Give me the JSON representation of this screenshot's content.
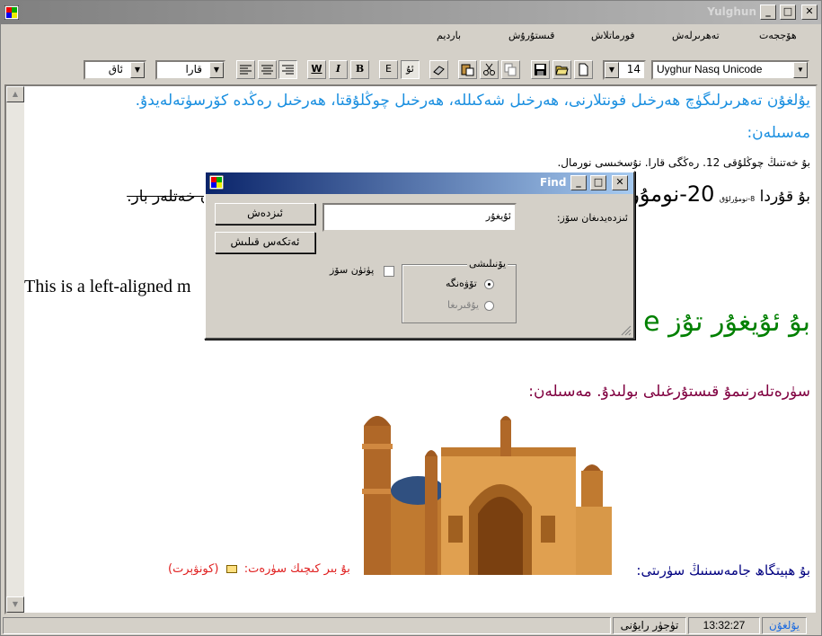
{
  "window": {
    "title": "Yulghun",
    "controls": {
      "minimize": "_",
      "maximize": "□",
      "close": "✕"
    }
  },
  "menu": {
    "items": [
      "بارديم",
      "قىستۇرۇش",
      "فورماتلاش",
      "تەھرىرلەش",
      "ھۆججەت"
    ]
  },
  "toolbar": {
    "font_name": "Uyghur Nasq Unicode",
    "font_size": "14",
    "color_combo": "قارا",
    "bg_combo": "ئاق",
    "buttons": {
      "bold": "B",
      "italic": "I",
      "underline": "W",
      "latin": "E",
      "uyghur": "ئۇ"
    }
  },
  "document": {
    "line1": "يۇلغۇن تەھرىرلىگۈچ ھەرخىل فونتلارنى، ھەرخىل شەكىللە، ھەرخىل چوڭلۇقتا، ھەرخىل رەڭدە كۆرسۈتەلەيدۇ.",
    "line2": "مەسىلەن:",
    "line3": "بۇ خەتنىڭ چوڭلۇقى 12. رەڭگى قارا. نۇسخىسى نورمال.",
    "line4_a": "بۇ قۇردا",
    "line4_small": "8-نومۇرلۇق",
    "line4_big": "20-نومۇر",
    "line4_end": "ئۆچۈرۈلگەن ۋە ئاستى سىزىلغان خەتلەر بار.",
    "english_line": "This is a left-aligned m",
    "green_line": "بۇ ئۇيغۇر تۇز e",
    "purple_line": "سۈرەتلەرنىمۇ قىستۇرغىلى بولىدۇ. مەسىلەن:",
    "mosque_caption": "بۇ ھېيتگاھ جامەسىنىڭ سۈرىتى:",
    "small_pic_caption": "بۇ بىر كىچىك سۈرەت:",
    "small_pic_label": "(كونۋېرت)"
  },
  "status": {
    "mode": "يۇلغۇن",
    "time": "13:32:27",
    "state": "تۈجۈر رايۇنى"
  },
  "find_dialog": {
    "title": "Find",
    "find_label": "ئىزدەيدىغان سۆز:",
    "find_value": "ئۇيغۇر",
    "find_button": "ئىزدەش",
    "cancel_button": "ئەتكەس قىلىش",
    "whole_word": "پۈتۈن سۆز",
    "direction_group": "يۆنىلىشى",
    "direction_down": "تۆۋەنگە",
    "direction_up": "يۇقىرىغا"
  },
  "colors": {
    "blue_text": "#1a8fe0",
    "green_text": "#008000",
    "purple_text": "#800040",
    "navy_text": "#000080",
    "red_text": "#e02020"
  }
}
